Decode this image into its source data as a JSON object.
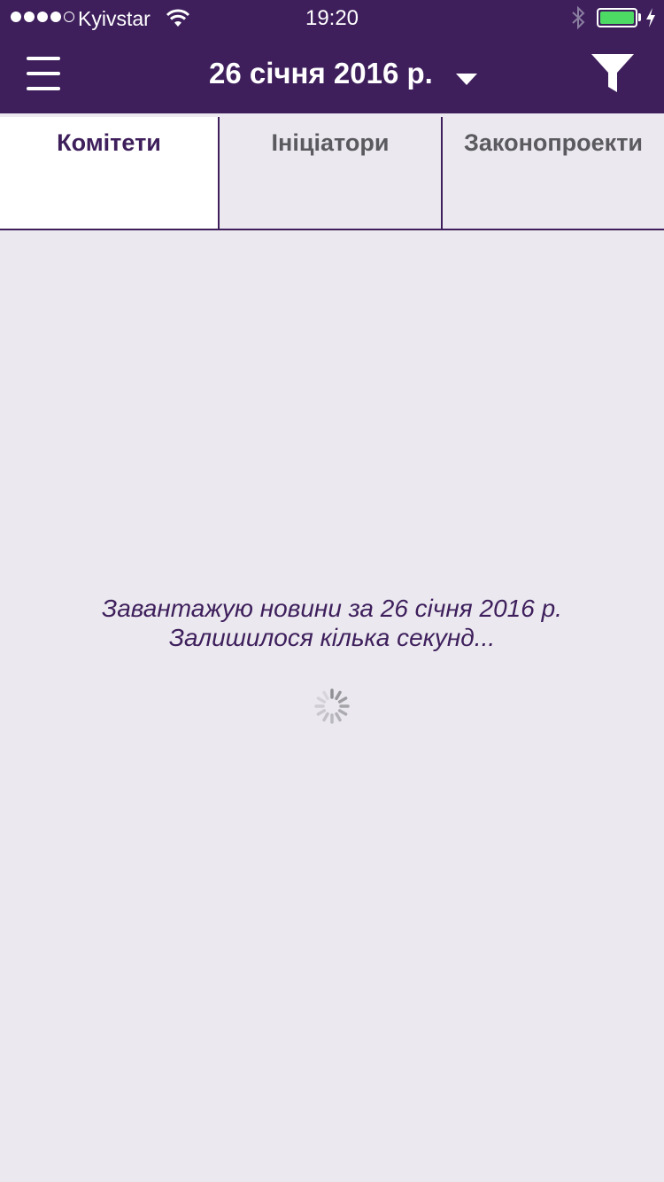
{
  "status_bar": {
    "carrier": "Kyivstar",
    "time": "19:20",
    "signal_bars_filled": 4,
    "signal_bars_total": 5,
    "battery_level": 1.0,
    "battery_color": "#4cd964",
    "charging": true,
    "icons": [
      "wifi-icon",
      "bluetooth-icon",
      "battery-icon",
      "charging-bolt-icon"
    ]
  },
  "navbar": {
    "date_title": "26 січня 2016 р.",
    "menu_icon": "hamburger-menu-icon",
    "dropdown_icon": "chevron-down-icon",
    "filter_icon": "filter-funnel-icon"
  },
  "tabs": [
    {
      "label": "Комітети",
      "active": true
    },
    {
      "label": "Ініціатори",
      "active": false
    },
    {
      "label": "Законопроекти",
      "active": false
    }
  ],
  "content": {
    "loading_line1": "Завантажую новини за 26 січня 2016 р.",
    "loading_line2": "Залишилося кілька секунд...",
    "spinner_icon": "loading-spinner-icon"
  },
  "colors": {
    "brand": "#3e1f5c",
    "background": "#ebe9ef",
    "active_tab_bg": "#ffffff",
    "inactive_tab_text": "#5b5b5f"
  }
}
